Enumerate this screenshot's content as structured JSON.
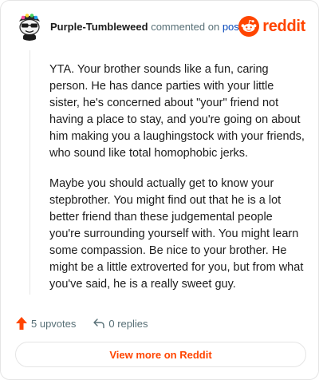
{
  "comment": {
    "username": "Purple-Tumbleweed",
    "action_text": "commented on",
    "post_link": "post",
    "paragraphs": [
      "YTA. Your brother sounds like a fun, caring person. He has dance parties with your little sister, he's concerned about \"your\" friend not having a place to stay, and you're going on about him making you a laughingstock with your friends, who sound like total homophobic jerks.",
      "Maybe you should actually get to know your stepbrother. You might find out that he is a lot better friend than these judgemental people you're surrounding yourself with. You might learn some compassion. Be nice to your brother. He might be a little extroverted for you, but from what you've said, he is a really sweet guy."
    ]
  },
  "brand": {
    "wordmark": "reddit",
    "color": "#ff4500"
  },
  "actions": {
    "upvotes": "5 upvotes",
    "replies": "0 replies"
  },
  "footer": {
    "view_more": "View more on Reddit"
  },
  "colors": {
    "accent": "#ff4500",
    "link": "#0b4bbb",
    "muted": "#576f76",
    "border": "#e5e5e5"
  },
  "icons": [
    "snoo-avatar-icon",
    "reddit-logo-icon",
    "upvote-arrow-icon",
    "reply-arrow-icon"
  ]
}
